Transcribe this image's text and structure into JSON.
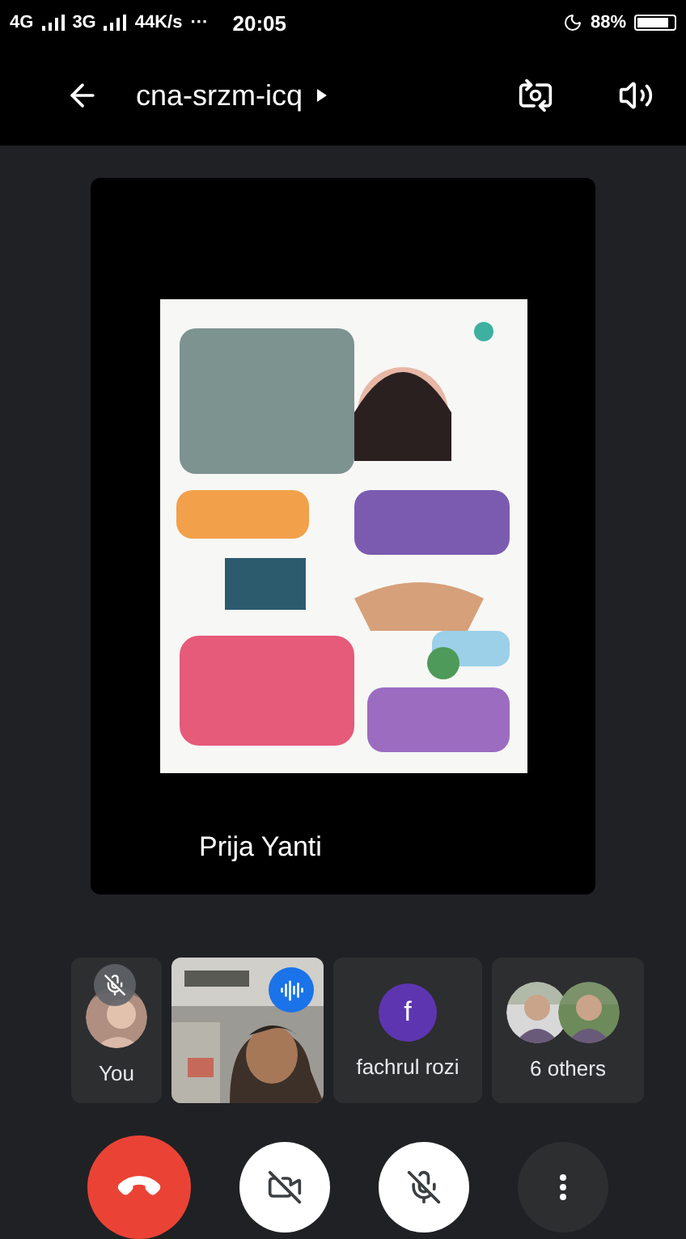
{
  "status_bar": {
    "network_1": "4G",
    "network_2": "3G",
    "speed": "44K/s",
    "more": "···",
    "time": "20:05",
    "battery": "88%"
  },
  "header": {
    "meeting_code": "cna-srzm-icq"
  },
  "presentation": {
    "kind": "picture",
    "presenter": "Prija Yanti"
  },
  "participants": [
    {
      "kind": "self",
      "name": "You",
      "muted": true
    },
    {
      "kind": "video",
      "speaking": true
    },
    {
      "kind": "initial",
      "initial": "f",
      "name": "fachrul rozi",
      "color": "#5e35b1"
    },
    {
      "kind": "group",
      "name": "6 others"
    }
  ],
  "controls": {
    "camera_on": false,
    "mic_on": false
  }
}
